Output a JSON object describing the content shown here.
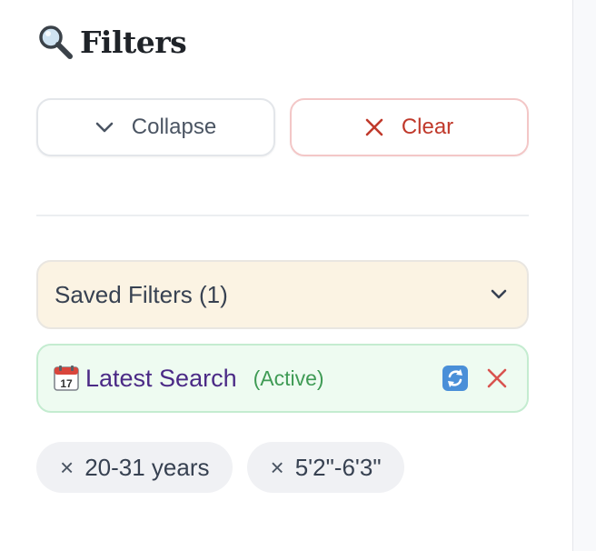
{
  "header": {
    "title": "Filters",
    "icon": "magnifying-glass-icon"
  },
  "actions": {
    "collapse_label": "Collapse",
    "collapse_icon": "chevron-down-icon",
    "clear_label": "Clear",
    "clear_icon": "close-icon"
  },
  "saved_filters": {
    "label": "Saved Filters (1)",
    "expand_icon": "chevron-down-icon",
    "items": [
      {
        "icon": "calendar-icon",
        "name": "Latest Search",
        "status": "(Active)",
        "actions": [
          "reload-icon",
          "remove-icon"
        ]
      }
    ]
  },
  "active_chips": [
    {
      "remove_glyph": "×",
      "label": "20-31 years"
    },
    {
      "remove_glyph": "×",
      "label": "5'2\"-6'3\""
    }
  ],
  "colors": {
    "saved_header_bg": "#fbf3e3",
    "saved_item_bg": "#eefbf1",
    "active_status": "#3f9b55",
    "saved_name": "#4b2a86",
    "danger": "#c0392b",
    "chip_bg": "#f0f1f4"
  }
}
